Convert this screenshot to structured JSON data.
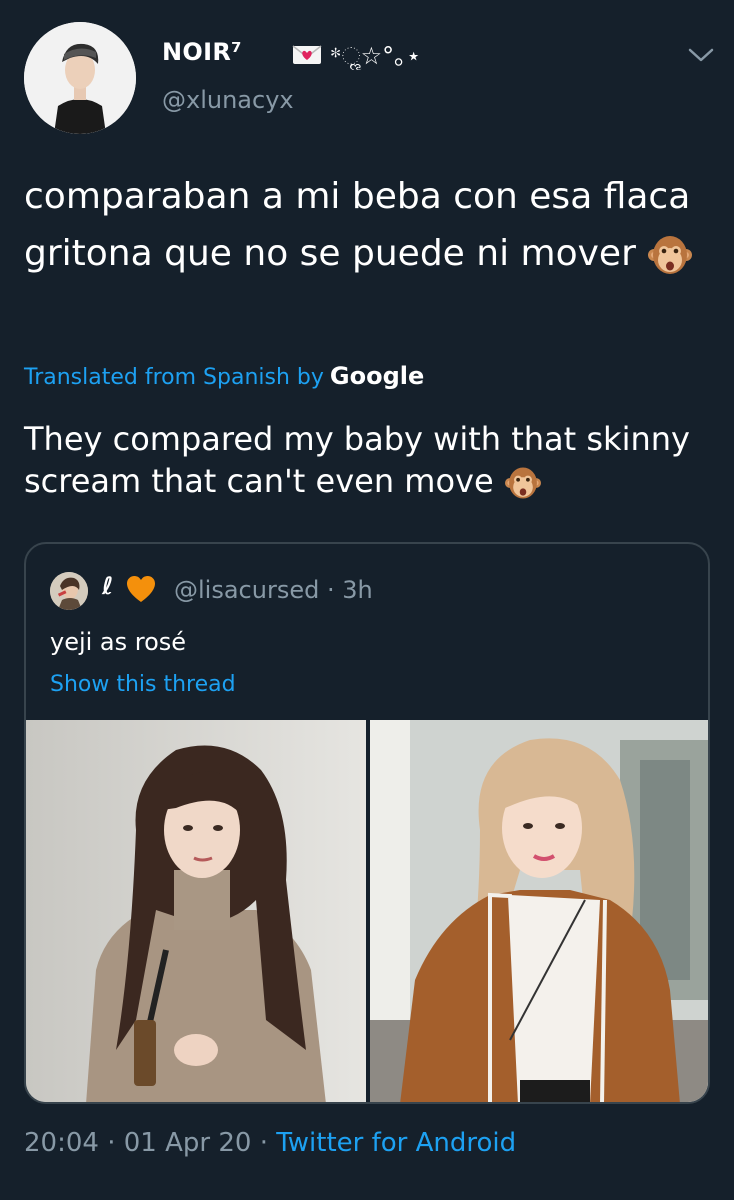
{
  "tweet": {
    "display_name": "NOIR⁷",
    "name_decoration": "*ૢ☆°｡⋆",
    "handle": "@xlunacyx",
    "text": "comparaban a mi beba con esa flaca gritona que no se puede ni mover",
    "translated_label": "Translated from Spanish by",
    "translator": "Google",
    "translation": "They compared my baby with that skinny scream that can't even move",
    "time": "20:04",
    "date": "01 Apr 20",
    "client": "Twitter for Android",
    "separator": "·"
  },
  "icons": {
    "name_icon": "love-letter-icon",
    "menu_icon": "chevron-down-icon",
    "emoji": "monkey-face-icon",
    "quote_heart": "orange-heart-icon"
  },
  "quote": {
    "display_name": "ℓ",
    "handle": "@lisacursed",
    "age": "3h",
    "text": "yeji as rosé",
    "show_thread": "Show this thread"
  },
  "colors": {
    "background": "#15202b",
    "link": "#1da1f2",
    "secondary_text": "#8899a6",
    "border": "#38444d"
  }
}
